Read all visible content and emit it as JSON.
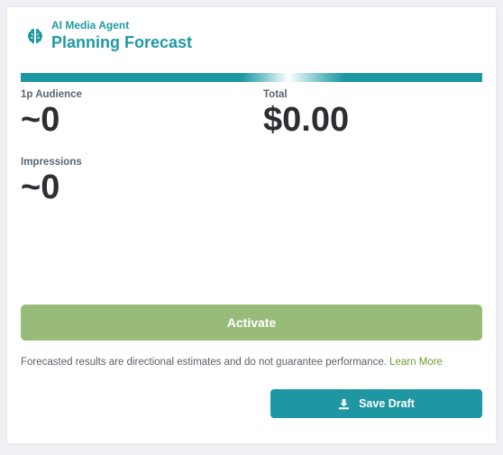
{
  "header": {
    "subtitle": "AI Media Agent",
    "title": "Planning Forecast",
    "icon": "brain-icon"
  },
  "metrics": [
    {
      "label": "1p Audience",
      "value": "~0"
    },
    {
      "label": "Total",
      "value": "$0.00"
    },
    {
      "label": "Impressions",
      "value": "~0"
    }
  ],
  "actions": {
    "activate_label": "Activate",
    "save_draft_label": "Save Draft",
    "save_icon": "download-icon"
  },
  "disclaimer": {
    "text": "Forecasted results are directional estimates and do not guarantee performance.",
    "link_label": "Learn More"
  },
  "colors": {
    "accent": "#1f97a2",
    "activate": "#98bb79",
    "link": "#6f9a2f",
    "value_text": "#2b2e33"
  }
}
